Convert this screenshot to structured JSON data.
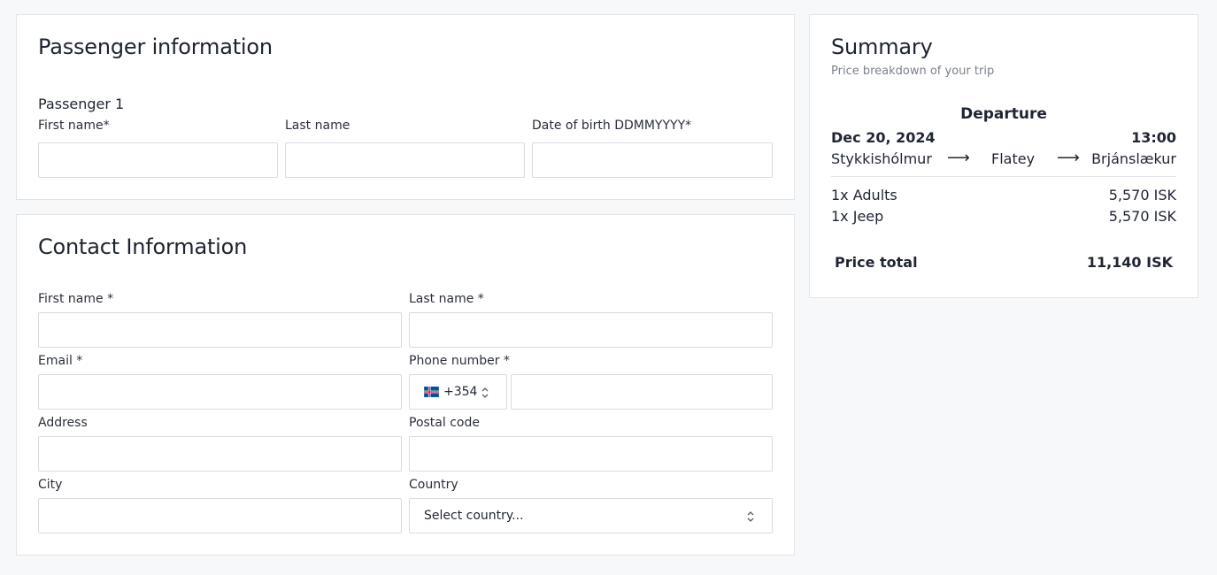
{
  "passenger_section": {
    "title": "Passenger information",
    "passenger_label": "Passenger 1",
    "first_name_label": "First name*",
    "last_name_label": "Last name",
    "dob_label": "Date of birth DDMMYYYY*",
    "first_name_value": "",
    "last_name_value": "",
    "dob_value": ""
  },
  "contact_section": {
    "title": "Contact Information",
    "first_name_label": "First name *",
    "last_name_label": "Last name *",
    "email_label": "Email *",
    "phone_label": "Phone number *",
    "phone_code": "+354",
    "phone_flag": "iceland-flag-icon",
    "address_label": "Address",
    "postal_label": "Postal code",
    "city_label": "City",
    "country_label": "Country",
    "country_selected": "Select country..."
  },
  "summary": {
    "title": "Summary",
    "subtitle": "Price breakdown of your trip",
    "trip_heading": "Departure",
    "date": "Dec 20, 2024",
    "time": "13:00",
    "route": [
      "Stykkishólmur",
      "Flatey",
      "Brjánslækur"
    ],
    "arrow": "⟶",
    "lines": [
      {
        "label": "1x Adults",
        "price": "5,570 ISK"
      },
      {
        "label": "1x Jeep",
        "price": "5,570 ISK"
      }
    ],
    "total_label": "Price total",
    "total_value": "11,140 ISK"
  },
  "colors": {
    "background": "#f7f8fa",
    "card": "#ffffff",
    "border": "#e2e4e8",
    "text": "#1f2532",
    "muted": "#7b818c"
  }
}
